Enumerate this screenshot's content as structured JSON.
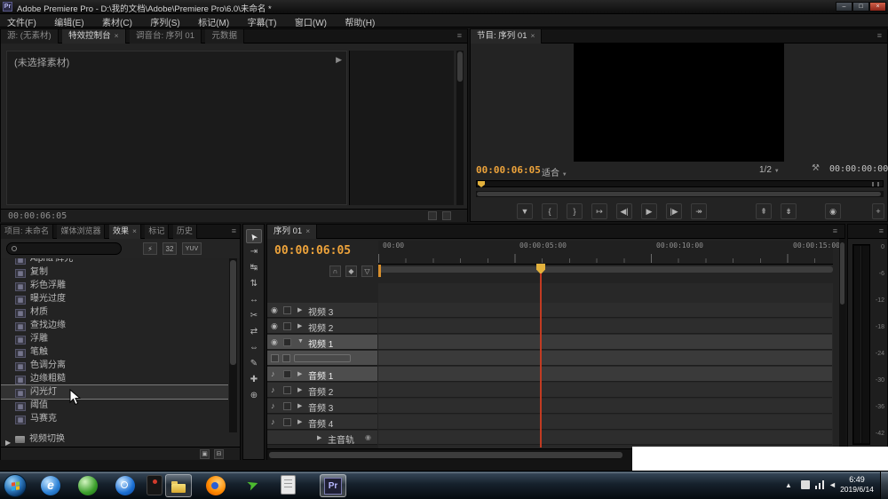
{
  "titlebar": {
    "icon_label": "Pr",
    "title": "Adobe Premiere Pro - D:\\我的文档\\Adobe\\Premiere Pro\\6.0\\未命名 *",
    "min": "–",
    "max": "□",
    "close": "×"
  },
  "menubar": {
    "items": [
      "文件(F)",
      "编辑(E)",
      "素材(C)",
      "序列(S)",
      "标记(M)",
      "字幕(T)",
      "窗口(W)",
      "帮助(H)"
    ]
  },
  "ui": {
    "close": "×",
    "panel_menu": "≡",
    "collapsed": "▶",
    "expanded": "▼",
    "dropdown": "▼",
    "eye": "◉",
    "speaker": "♪"
  },
  "source_panel": {
    "tabs": [
      "源: (无素材)",
      "特效控制台",
      "调音台: 序列 01",
      "元数据"
    ],
    "empty_message": "(未选择素材)",
    "show_button": "▶",
    "timecode": "00:00:06:05"
  },
  "program_panel": {
    "tab": "节目: 序列 01",
    "timecode_current": "00:00:06:05",
    "fit": "适合",
    "quality": "1/2",
    "wrench": "⚒",
    "timecode_total": "00:00:00:00",
    "transport": [
      "▼",
      "{",
      "}",
      "↦",
      "◀|",
      "▶",
      "|▶",
      "↠"
    ],
    "transport_right": [
      "⇞",
      "⇟",
      "◉"
    ],
    "add": "+"
  },
  "project_panel": {
    "tabs": [
      "项目: 未命名",
      "媒体浏览器",
      "效果",
      "标记",
      "历史"
    ],
    "filters": [
      "⚡",
      "32",
      "YUV"
    ],
    "effect_icon": "▦",
    "effects": [
      "Alpha 辉光",
      "复制",
      "彩色浮雕",
      "曝光过度",
      "材质",
      "查找边缘",
      "浮雕",
      "笔触",
      "色调分离",
      "边缘粗糙",
      "闪光灯",
      "阈值",
      "马赛克"
    ],
    "selected_effect": "闪光灯",
    "folder": "视频切换",
    "bin_icon": "▣",
    "trash_icon": "⊟"
  },
  "tools": {
    "items": [
      {
        "name": "selection",
        "glyph": "➤"
      },
      {
        "name": "track-select",
        "glyph": "⇥"
      },
      {
        "name": "ripple-edit",
        "glyph": "↹"
      },
      {
        "name": "rolling-edit",
        "glyph": "⇅"
      },
      {
        "name": "rate-stretch",
        "glyph": "↔"
      },
      {
        "name": "razor",
        "glyph": "✂"
      },
      {
        "name": "slip",
        "glyph": "⇄"
      },
      {
        "name": "slide",
        "glyph": "⇔"
      },
      {
        "name": "pen",
        "glyph": "✎"
      },
      {
        "name": "hand",
        "glyph": "✚"
      },
      {
        "name": "zoom",
        "glyph": "⊕"
      }
    ]
  },
  "timeline": {
    "tab": "序列 01",
    "timecode": "00:00:06:05",
    "header_icons": [
      "∩",
      "◆",
      "▽"
    ],
    "ruler_labels": [
      "00:00",
      "00:00:05:00",
      "00:00:10:00",
      "00:00:15:00"
    ],
    "video_tracks": [
      "视频 3",
      "视频 2",
      "视频 1"
    ],
    "audio_tracks": [
      "音频 1",
      "音频 2",
      "音频 3",
      "音频 4"
    ],
    "master_track": "主音轨"
  },
  "meters": {
    "labels": [
      "0",
      "-6",
      "-12",
      "-18",
      "-24",
      "-30",
      "-36",
      "-42"
    ]
  },
  "taskbar": {
    "ie_label": "e",
    "premiere_label": "Pr",
    "tray_hidden": "▲",
    "volume": "◄",
    "time": "6:49",
    "date": "2019/6/14"
  }
}
